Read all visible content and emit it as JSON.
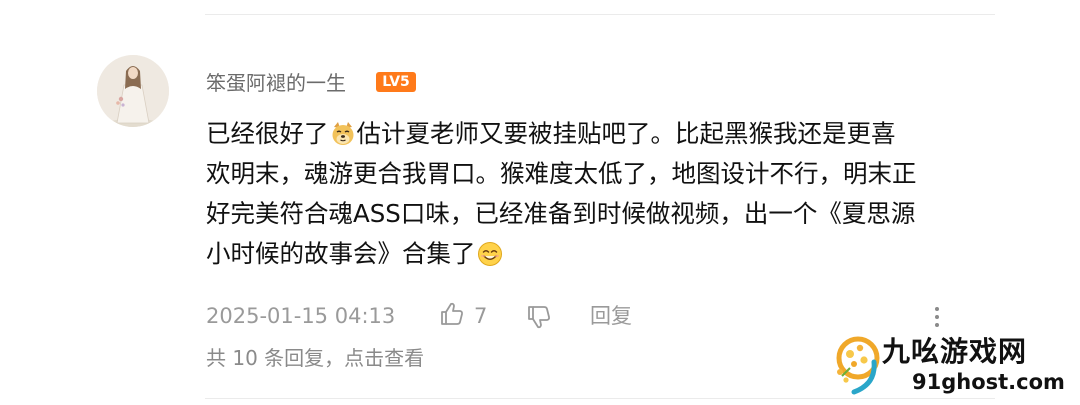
{
  "comment": {
    "username": "笨蛋阿褪的一生",
    "level_badge": "LV5",
    "body_lines": [
      {
        "before_emoji": "已经很好了",
        "after_emoji": "估计夏老师又要被挂贴吧了。比起黑猴我还是更喜",
        "emoji": "doge-emoji"
      },
      {
        "text": "欢明末，魂游更合我胃口。猴难度太低了，地图设计不行，明末正"
      },
      {
        "text": "好完美符合魂ASS口味，已经准备到时候做视频，出一个《夏思源"
      },
      {
        "text": "小时候的故事会》合集了",
        "emoji": "smile-emoji"
      }
    ],
    "timestamp": "2025-01-15 04:13",
    "like_count": "7",
    "reply_label": "回复",
    "replies_summary": "共 10 条回复，点击查看"
  },
  "watermark": {
    "title": "九吆游戏网",
    "url": "91ghost.com"
  },
  "colors": {
    "badge": "#ff7a1a",
    "meta_text": "#9a9a9a",
    "username": "#6b6b6b",
    "body_text": "#111111"
  }
}
